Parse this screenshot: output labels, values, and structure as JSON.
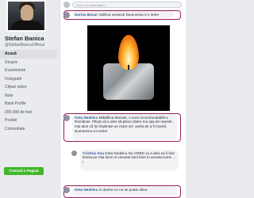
{
  "profile": {
    "name": "Stefan Banica",
    "handle": "@StefanBanicaOfficial"
  },
  "nav": {
    "items": [
      {
        "label": "Acasă",
        "active": true
      },
      {
        "label": "Despre",
        "active": false
      },
      {
        "label": "Evenimente",
        "active": false
      },
      {
        "label": "Fotografii",
        "active": false
      },
      {
        "label": "Clipuri video",
        "active": false
      },
      {
        "label": "Note",
        "active": false
      },
      {
        "label": "Banii Profile",
        "active": false
      },
      {
        "label": "200.000 de fani",
        "active": false
      },
      {
        "label": "Postări",
        "active": false
      },
      {
        "label": "Comunitate",
        "active": false
      }
    ],
    "create_label": "Creează o Pagină"
  },
  "feed": {
    "write_placeholder": "Scrie un comentariu...",
    "comments": [
      {
        "author": "Dorina Bucur",
        "text": "Odihna vesnica! Dumnezeu s-o ierte!"
      },
      {
        "author": "Geta Nedelcu",
        "text": "Mădălina Manole, o voce incomfundabilă a României. Păcat că a ales să plece dintre noi așa de repede, mai ales că își împlinise un mare vis: acela de a fi mamă. Dumnezeu s-o ierte!"
      },
      {
        "author": "Cristina Ana",
        "text": "Geta Nedelcu Nu CRED ca a ales sa fi fost timisa pe Alta lume si vinovati sant bine in aceasa lume ... !"
      },
      {
        "author": "Geta Nedelcu",
        "text": "O durere ce nu se poate alina"
      }
    ]
  },
  "colors": {
    "highlight": "#9b1b5a",
    "create_button": "#42b72a",
    "link": "#385898"
  }
}
